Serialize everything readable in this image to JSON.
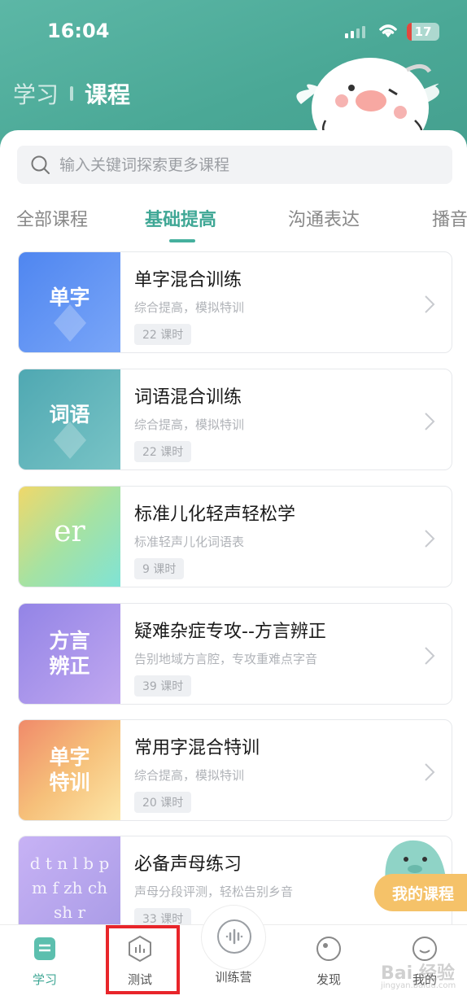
{
  "status": {
    "time": "16:04",
    "battery": "17"
  },
  "header": {
    "tab_study": "学习",
    "tab_course": "课程"
  },
  "search": {
    "placeholder": "输入关键词探索更多课程"
  },
  "categories": [
    "全部课程",
    "基础提高",
    "沟通表达",
    "播音"
  ],
  "active_category": "基础提高",
  "courses": [
    {
      "thumb": "单字",
      "title": "单字混合训练",
      "subtitle": "综合提高，模拟特训",
      "lessons": "22 课时",
      "color": "#5f8ff5"
    },
    {
      "thumb": "词语",
      "title": "词语混合训练",
      "subtitle": "综合提高，模拟特训",
      "lessons": "22 课时",
      "color": "#5bb3b8"
    },
    {
      "thumb": "er",
      "title": "标准儿化轻声轻松学",
      "subtitle": "标准轻声儿化词语表",
      "lessons": "9 课时",
      "color": "#b6d97a"
    },
    {
      "thumb": "方言 辨正",
      "title": "疑难杂症专攻--方言辨正",
      "subtitle": "告别地域方言腔，专攻重难点字音",
      "lessons": "39 课时",
      "color": "#a48be8"
    },
    {
      "thumb": "单字 特训",
      "title": "常用字混合特训",
      "subtitle": "综合提高，模拟特训",
      "lessons": "20 课时",
      "color": "#f29a6e"
    },
    {
      "thumb": "d t n l b p m f zh ch sh r",
      "title": "必备声母练习",
      "subtitle": "声母分段评测，轻松告别乡音",
      "lessons": "33 课时",
      "color": "#b9a6f0"
    }
  ],
  "float_button": "我的课程",
  "bottom_nav": {
    "study": "学习",
    "test": "测试",
    "camp": "训练营",
    "discover": "发现",
    "mine": "我的"
  },
  "watermark": {
    "main": "Bai 经验",
    "sub": "jingyan.baidu.com"
  },
  "colors": {
    "accent": "#45b09e",
    "highlight": "#e8252a"
  }
}
